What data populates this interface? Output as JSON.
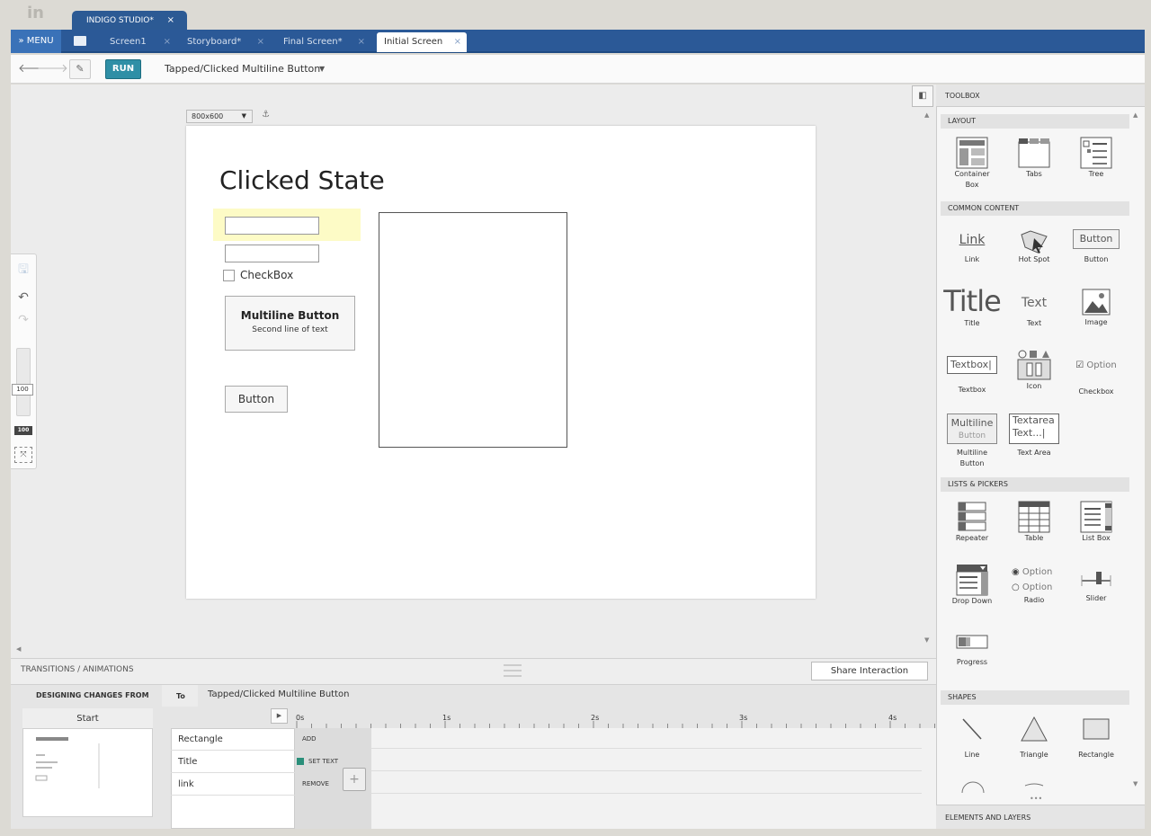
{
  "app": {
    "tab_label": "INDIGO STUDIO*",
    "close": "×"
  },
  "menu": {
    "label": "» MENU"
  },
  "doc_tabs": [
    {
      "label": "Screen1",
      "close": "×"
    },
    {
      "label": "Storyboard*",
      "close": "×"
    },
    {
      "label": "Final Screen*",
      "close": "×"
    },
    {
      "label": "Initial Screen",
      "close": "×"
    }
  ],
  "toolbar": {
    "run_label": "RUN",
    "state_label": "Tapped/Clicked Multiline Button",
    "state_caret": "▼"
  },
  "canvas": {
    "resolution": "800x600",
    "title": "Clicked State",
    "checkbox_label": "CheckBox",
    "multiline_button": {
      "line1": "Multiline Button",
      "line2": "Second line of text"
    },
    "button_label": "Button"
  },
  "zoom": {
    "value": "100",
    "reset": "100"
  },
  "transitions": {
    "label": "TRANSITIONS / ANIMATIONS",
    "share_label": "Share Interaction"
  },
  "timeline": {
    "designing_label": "DESIGNING CHANGES FROM",
    "to_label": "To",
    "to_state": "Tapped/Clicked Multiline Button",
    "start_label": "Start",
    "ticks": [
      "0s",
      "1s",
      "2s",
      "3s",
      "4s"
    ],
    "layers": [
      "Rectangle",
      "Title",
      "link"
    ],
    "actions": [
      "ADD",
      "SET TEXT",
      "REMOVE"
    ]
  },
  "toolbox": {
    "header": "TOOLBOX",
    "sections": {
      "layout": "LAYOUT",
      "common": "COMMON CONTENT",
      "lists": "LISTS & PICKERS",
      "shapes": "SHAPES"
    },
    "layout_tools": [
      "Container\nBox",
      "Tabs",
      "Tree"
    ],
    "common_tools": [
      "Link",
      "Hot Spot",
      "Button",
      "Title",
      "Text",
      "Image",
      "Textbox",
      "Icon",
      "Checkbox",
      "Multiline\nButton",
      "Text Area"
    ],
    "common_previews": {
      "link": "Link",
      "button": "Button",
      "title": "Title",
      "text": "Text",
      "textbox": "Textbox|",
      "option": "Option",
      "ml1": "Multiline",
      "ml2": "Button",
      "ta1": "Textarea",
      "ta2": "Text...|"
    },
    "list_tools": [
      "Repeater",
      "Table",
      "List Box",
      "Drop Down",
      "Radio",
      "Slider",
      "Progress"
    ],
    "radio_options": [
      "Option",
      "Option"
    ],
    "shape_tools": [
      "Line",
      "Triangle",
      "Rectangle"
    ],
    "elements_label": "ELEMENTS AND LAYERS",
    "grip": "•••"
  },
  "colors": {
    "tab_blue": "#2b5997",
    "run_teal": "#2f8fa6",
    "highlight": "#fdfbc6",
    "swatch": "#2a8f7a"
  }
}
